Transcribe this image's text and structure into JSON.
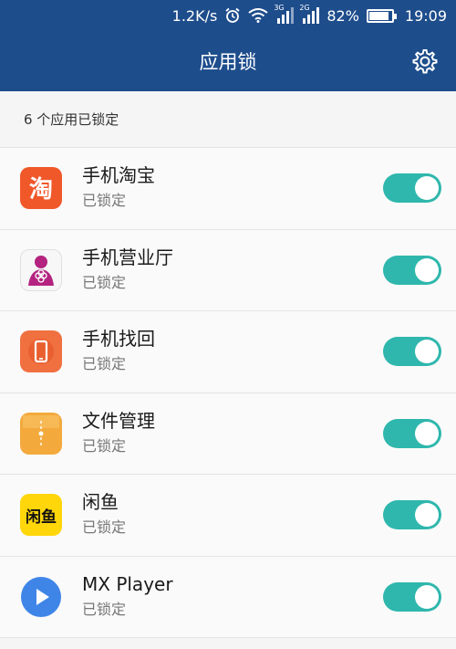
{
  "statusbar": {
    "net_speed": "1.2K/s",
    "sim1_label": "3G",
    "sim2_label": "2G",
    "battery_percent": "82%",
    "battery_level": 0.82,
    "time": "19:09"
  },
  "appbar": {
    "title": "应用锁",
    "settings_icon": "gear-icon"
  },
  "summary": "6 个应用已锁定",
  "apps": [
    {
      "name": "手机淘宝",
      "status": "已锁定",
      "icon": "taobao-icon",
      "locked": true
    },
    {
      "name": "手机营业厅",
      "status": "已锁定",
      "icon": "unicom-icon",
      "locked": true
    },
    {
      "name": "手机找回",
      "status": "已锁定",
      "icon": "phone-finder-icon",
      "locked": true
    },
    {
      "name": "文件管理",
      "status": "已锁定",
      "icon": "file-manager-icon",
      "locked": true
    },
    {
      "name": "闲鱼",
      "status": "已锁定",
      "icon": "xianyu-icon",
      "locked": true
    },
    {
      "name": "MX Player",
      "status": "已锁定",
      "icon": "mx-player-icon",
      "locked": true
    }
  ],
  "colors": {
    "header": "#1e4d8c",
    "toggle_on": "#2fb7ad",
    "taobao": "#f0582a",
    "unicom": "#b3237f",
    "finder": "#f07040",
    "files": "#f3a93c",
    "xianyu": "#ffd60a",
    "mx": "#3f85e8"
  }
}
